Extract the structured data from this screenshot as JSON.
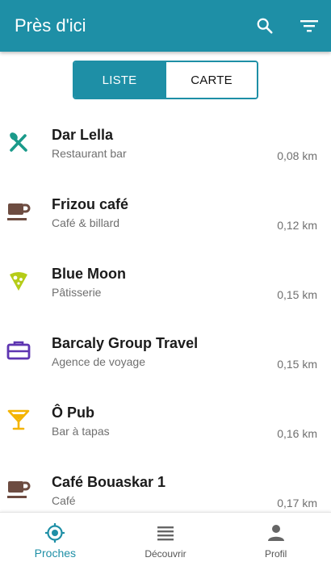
{
  "header": {
    "title": "Près d'ici",
    "search_icon": "search-icon",
    "filter_icon": "filter-icon",
    "brand_color": "#1e8fa6"
  },
  "view_toggle": {
    "selected": "LISTE",
    "options": [
      "LISTE",
      "CARTE"
    ]
  },
  "places": [
    {
      "name": "Dar Lella",
      "category": "Restaurant bar",
      "distance": "0,08 km",
      "icon": "restaurant-icon",
      "icon_color": "#1a9a8a"
    },
    {
      "name": "Frizou café",
      "category": "Café & billard",
      "distance": "0,12 km",
      "icon": "coffee-cup-icon",
      "icon_color": "#6d4c41"
    },
    {
      "name": "Blue Moon",
      "category": "Pâtisserie",
      "distance": "0,15 km",
      "icon": "pastry-icon",
      "icon_color": "#b5cc18"
    },
    {
      "name": "Barcaly Group Travel",
      "category": "Agence de voyage",
      "distance": "0,15 km",
      "icon": "briefcase-icon",
      "icon_color": "#5e35b1"
    },
    {
      "name": "Ô Pub",
      "category": "Bar à tapas",
      "distance": "0,16 km",
      "icon": "cocktail-icon",
      "icon_color": "#f4b400"
    },
    {
      "name": "Café Bouaskar 1",
      "category": "Café",
      "distance": "0,17 km",
      "icon": "coffee-cup-icon",
      "icon_color": "#6d4c41"
    }
  ],
  "bottom_nav": {
    "items": [
      {
        "label": "Proches",
        "icon": "location-target-icon",
        "active": true
      },
      {
        "label": "Découvrir",
        "icon": "list-icon",
        "active": false
      },
      {
        "label": "Profil",
        "icon": "person-icon",
        "active": false
      }
    ]
  }
}
